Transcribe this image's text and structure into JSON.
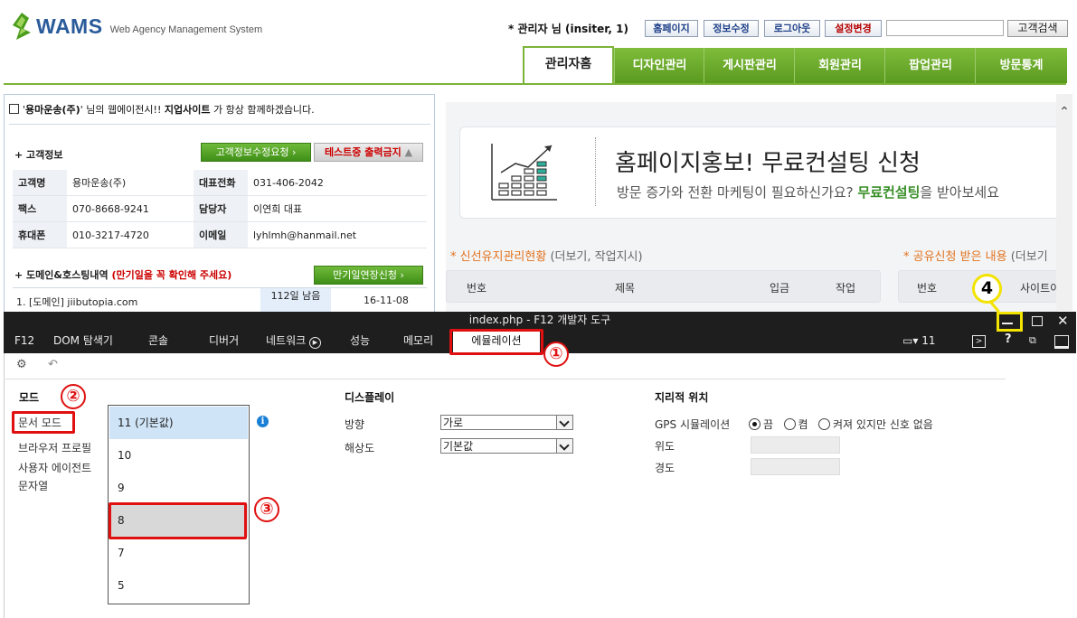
{
  "header": {
    "logo_word": "WAMS",
    "logo_subtitle": "Web Agency Management System",
    "admin_info": "* 관리자 님 (insiter, 1)",
    "buttons": [
      "홈페이지",
      "정보수정",
      "로그아웃",
      "설정변경"
    ],
    "search_button": "고객검색"
  },
  "nav": {
    "tabs": [
      "관리자홈",
      "디자인관리",
      "게시판관리",
      "회원관리",
      "팝업관리",
      "방문통계"
    ]
  },
  "welcome": {
    "quote_open": "'",
    "company": "용마운송(주)",
    "mid": "' 님의 웹에이전시!! ",
    "brand": "지업사이트",
    "tail": " 가 항상 함께하겠습니다."
  },
  "customer": {
    "section_title": "+ 고객정보",
    "edit_request_btn": "고객정보수정요청",
    "test_btn": "테스트중 출력금지",
    "rows": [
      {
        "label1": "고객명",
        "value1": "용마운송(주)",
        "label2": "대표전화",
        "value2": "031-406-2042"
      },
      {
        "label1": "팩스",
        "value1": "070-8668-9241",
        "label2": "담당자",
        "value2": "이연희 대표"
      },
      {
        "label1": "휴대폰",
        "value1": "010-3217-4720",
        "label2": "이메일",
        "value2": "lyhlmh@hanmail.net"
      }
    ]
  },
  "domain": {
    "section_title": "+ 도메인&호스팅내역",
    "note": "(만기일을 꼭 확인해 주세요)",
    "extend_btn": "만기일연장신청",
    "row": {
      "name": "1. [도메인] jiibutopia.com",
      "days_left": "112일 남음",
      "expiry": "16-11-08"
    }
  },
  "promo": {
    "title": "홈페이지홍보! 무료컨설팅 신청",
    "sub_a": "방문 증가와 전환 마케팅이 필요하신가요? ",
    "sub_hl": "무료컨설팅",
    "sub_b": "을 받아보세요"
  },
  "maintenance": {
    "heading": "* 신선유지관리현황",
    "more": " (더보기, 작업지시)",
    "columns": [
      "번호",
      "제목",
      "입금",
      "작업"
    ]
  },
  "shared": {
    "heading": "* 공유신청 받은 내용",
    "more": " (더보기",
    "columns": [
      "번호",
      "사이트이"
    ]
  },
  "devtools": {
    "title": "index.php - F12 개발자 도구",
    "tabs": [
      "F12",
      "DOM 탐색기",
      "콘솔",
      "디버거",
      "네트워크",
      "성능",
      "메모리",
      "에뮬레이션"
    ],
    "active_tab": "에뮬레이션",
    "doc_mode_count": "11",
    "mode": {
      "heading": "모드",
      "items": [
        "문서 모드",
        "브라우저 프로필",
        "사용자 에이전트",
        "문자열"
      ],
      "doc_modes": [
        "11 (기본값)",
        "10",
        "9",
        "8",
        "7",
        "5"
      ],
      "info_glyph": "i"
    },
    "display": {
      "heading": "디스플레이",
      "orientation_label": "방향",
      "orientation_value": "가로",
      "resolution_label": "해상도",
      "resolution_value": "기본값"
    },
    "geo": {
      "heading": "지리적 위치",
      "gps_label": "GPS 시뮬레이션",
      "options": [
        "끔",
        "켬",
        "켜져 있지만 신호 없음"
      ],
      "selected_option": "끔",
      "lat_label": "위도",
      "lon_label": "경도"
    }
  },
  "annotations": {
    "n1": "①",
    "n2": "②",
    "n3": "③",
    "n4": "4"
  }
}
